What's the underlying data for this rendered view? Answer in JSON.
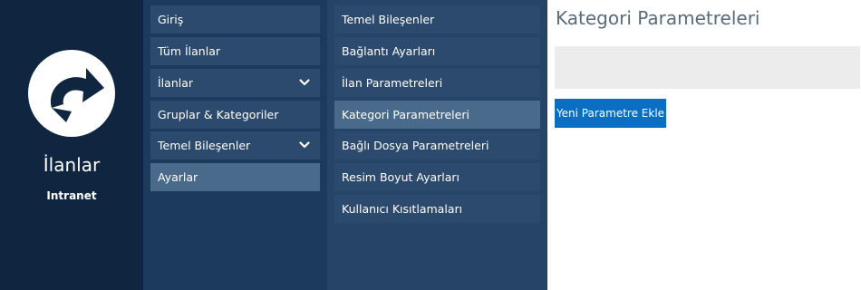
{
  "brand": {
    "logo_icon": "redo-arrow-circle-icon",
    "title": "İlanlar",
    "subtitle": "Intranet"
  },
  "nav1": {
    "items": [
      {
        "label": "Giriş"
      },
      {
        "label": "Tüm İlanlar"
      },
      {
        "label": "İlanlar",
        "icon": "chevron-down-icon"
      },
      {
        "label": "Gruplar & Kategoriler"
      },
      {
        "label": "Temel Bileşenler",
        "icon": "chevron-down-icon"
      },
      {
        "label": "Ayarlar",
        "active": true
      }
    ]
  },
  "nav2": {
    "items": [
      {
        "label": "Temel Bileşenler"
      },
      {
        "label": "Bağlantı Ayarları"
      },
      {
        "label": "İlan Parametreleri"
      },
      {
        "label": "Kategori Parametreleri",
        "active": true
      },
      {
        "label": "Bağlı Dosya Parametreleri"
      },
      {
        "label": "Resim Boyut Ayarları"
      },
      {
        "label": "Kullanıcı Kısıtlamaları"
      }
    ]
  },
  "main": {
    "title": "Kategori Parametreleri",
    "new_button_label": "Yeni Parametre Ekle"
  },
  "colors": {
    "brand_bg": "#0f2540",
    "nav1_bg": "#1b3a5c",
    "nav2_bg": "#254466",
    "item_bg": "#2c4a6d",
    "item_active_bg": "#4a6a8c",
    "button_bg": "#0a6fc2"
  }
}
